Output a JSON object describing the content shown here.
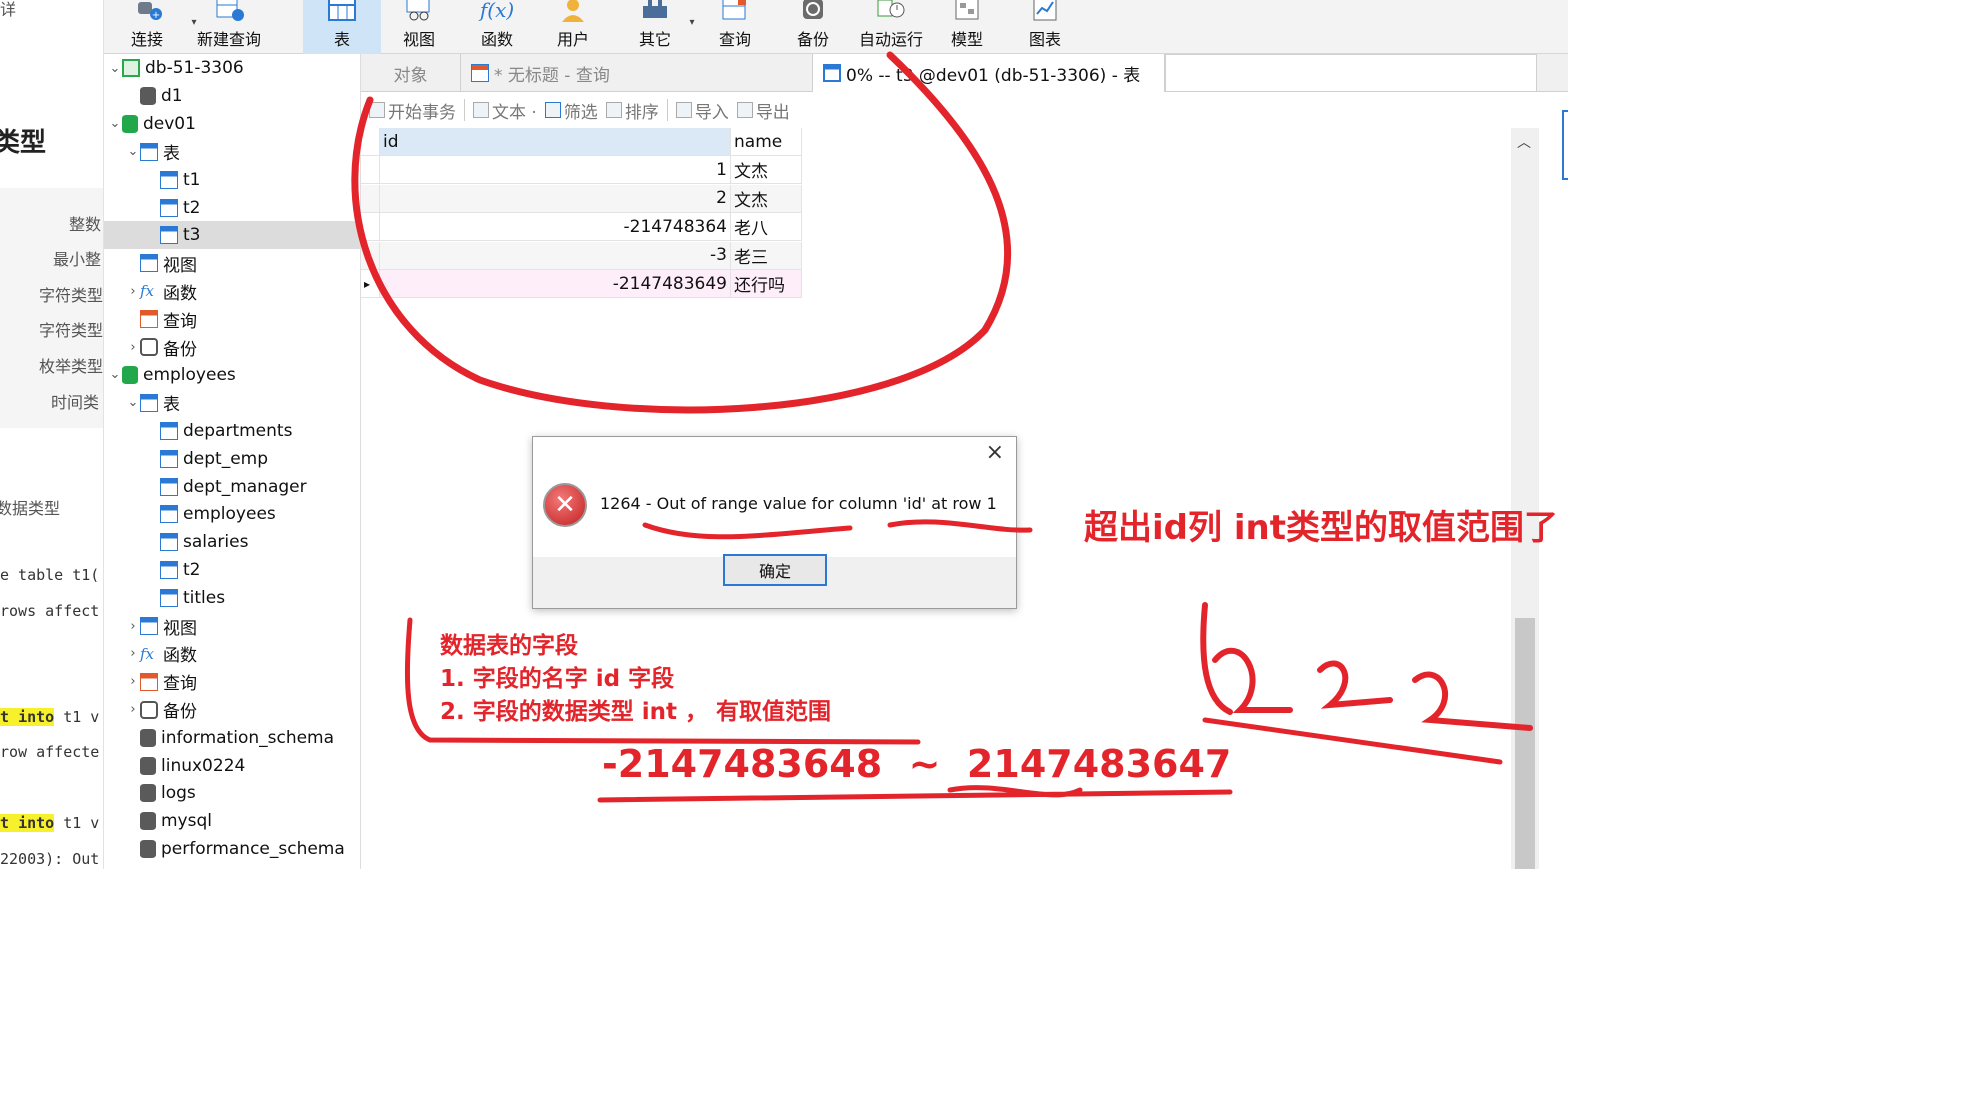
{
  "doc_strip": {
    "top_fragment": "详",
    "title_fragment": "类型",
    "list": [
      "整数",
      "最小整",
      "字符类型",
      "字符类型",
      "枚举类型",
      "时间类"
    ],
    "section": "数据类型",
    "code": [
      "e table t1(",
      "rows affect",
      "t into t1 v",
      "row affecte",
      "t into t1 v",
      "22003): Out"
    ],
    "kw": "into"
  },
  "toolbar": {
    "items": [
      {
        "label": "连接",
        "icon": "connect-icon"
      },
      {
        "label": "新建查询",
        "icon": "new-query-icon"
      },
      {
        "label": "表",
        "icon": "table-icon"
      },
      {
        "label": "视图",
        "icon": "view-icon"
      },
      {
        "label": "函数",
        "icon": "function-icon"
      },
      {
        "label": "用户",
        "icon": "user-icon"
      },
      {
        "label": "其它",
        "icon": "other-icon"
      },
      {
        "label": "查询",
        "icon": "query-icon"
      },
      {
        "label": "备份",
        "icon": "backup-icon"
      },
      {
        "label": "自动运行",
        "icon": "auto-run-icon"
      },
      {
        "label": "模型",
        "icon": "model-icon"
      },
      {
        "label": "图表",
        "icon": "chart-icon"
      }
    ]
  },
  "tree": {
    "nodes": [
      {
        "label": "db-51-3306",
        "icon": "connection-icon",
        "chevron": "expanded"
      },
      {
        "label": "d1",
        "icon": "database-icon",
        "chevron": ""
      },
      {
        "label": "dev01",
        "icon": "database-open-icon",
        "chevron": "expanded"
      },
      {
        "label": "表",
        "icon": "table-folder-icon",
        "chevron": "expanded"
      },
      {
        "label": "t1",
        "icon": "table-icon",
        "chevron": ""
      },
      {
        "label": "t2",
        "icon": "table-icon",
        "chevron": ""
      },
      {
        "label": "t3",
        "icon": "table-icon",
        "chevron": "",
        "selected": true
      },
      {
        "label": "视图",
        "icon": "view-icon",
        "chevron": ""
      },
      {
        "label": "函数",
        "icon": "function-icon",
        "chevron": "collapsed"
      },
      {
        "label": "查询",
        "icon": "query-icon",
        "chevron": ""
      },
      {
        "label": "备份",
        "icon": "backup-icon",
        "chevron": "collapsed"
      },
      {
        "label": "employees",
        "icon": "database-open-icon",
        "chevron": "expanded"
      },
      {
        "label": "表",
        "icon": "table-folder-icon",
        "chevron": "expanded"
      },
      {
        "label": "departments",
        "icon": "table-icon",
        "chevron": ""
      },
      {
        "label": "dept_emp",
        "icon": "table-icon",
        "chevron": ""
      },
      {
        "label": "dept_manager",
        "icon": "table-icon",
        "chevron": ""
      },
      {
        "label": "employees",
        "icon": "table-icon",
        "chevron": ""
      },
      {
        "label": "salaries",
        "icon": "table-icon",
        "chevron": ""
      },
      {
        "label": "t2",
        "icon": "table-icon",
        "chevron": ""
      },
      {
        "label": "titles",
        "icon": "table-icon",
        "chevron": ""
      },
      {
        "label": "视图",
        "icon": "view-icon",
        "chevron": "collapsed"
      },
      {
        "label": "函数",
        "icon": "function-icon",
        "chevron": "collapsed"
      },
      {
        "label": "查询",
        "icon": "query-icon",
        "chevron": "collapsed"
      },
      {
        "label": "备份",
        "icon": "backup-icon",
        "chevron": "collapsed"
      },
      {
        "label": "information_schema",
        "icon": "database-icon",
        "chevron": ""
      },
      {
        "label": "linux0224",
        "icon": "database-icon",
        "chevron": ""
      },
      {
        "label": "logs",
        "icon": "database-icon",
        "chevron": ""
      },
      {
        "label": "mysql",
        "icon": "database-icon",
        "chevron": ""
      },
      {
        "label": "performance_schema",
        "icon": "database-icon",
        "chevron": ""
      }
    ]
  },
  "tabs": [
    {
      "label": "对象"
    },
    {
      "label": "* 无标题 - 查询"
    },
    {
      "label": "0% -- t3 @dev01 (db-51-3306) - 表"
    }
  ],
  "subtoolbar": [
    "开始事务",
    "文本 ·",
    "筛选",
    "排序",
    "导入",
    "导出"
  ],
  "grid": {
    "columns": [
      "id",
      "name"
    ],
    "rows": [
      {
        "id": "1",
        "name": "文杰"
      },
      {
        "id": "2",
        "name": "文杰"
      },
      {
        "id": "-214748364",
        "name": "老八"
      },
      {
        "id": "-3",
        "name": "老三"
      },
      {
        "id": "-2147483649",
        "name": "还行吗"
      }
    ]
  },
  "dialog": {
    "message": "1264 - Out of range value for column 'id' at row 1",
    "ok": "确定",
    "close": "×"
  },
  "annotations": {
    "right_note": "超出id列 int类型的取值范围了",
    "notes": [
      "数据表的字段",
      "1.  字段的名字  id 字段",
      "2.  字段的数据类型  int ， 有取值范围"
    ],
    "range": "-2147483648  ~  2147483647",
    "scribble": "2-2-2"
  },
  "colors": {
    "accent": "#2a7ad5",
    "annotation": "#e3242b",
    "selection": "#cfe4f7"
  }
}
